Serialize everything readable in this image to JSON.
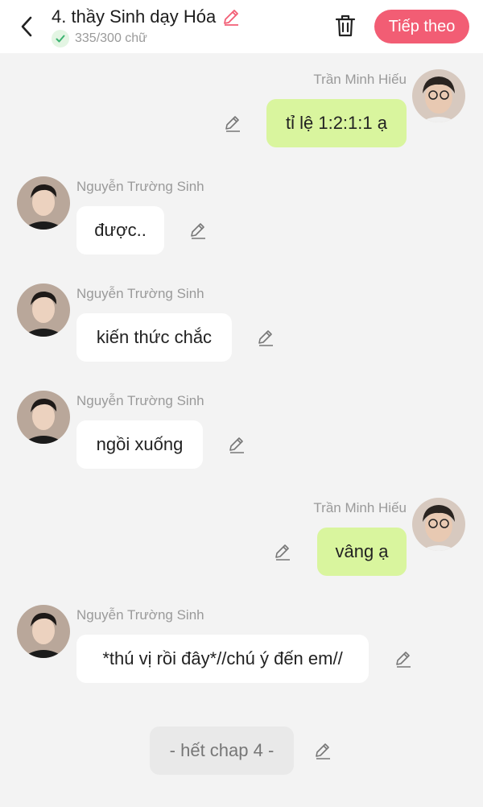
{
  "header": {
    "title": "4. thầy Sinh dạy Hóa",
    "word_count": "335/300 chữ",
    "next_label": "Tiếp theo",
    "accent_color": "#f25d74"
  },
  "messages": [
    {
      "sender": "Trần Minh Hiếu",
      "text": "tỉ lệ 1:2:1:1 ạ",
      "side": "right"
    },
    {
      "sender": "Nguyễn Trường Sinh",
      "text": "được..",
      "side": "left"
    },
    {
      "sender": "Nguyễn Trường Sinh",
      "text": "kiến thức chắc",
      "side": "left"
    },
    {
      "sender": "Nguyễn Trường Sinh",
      "text": "ngồi xuống",
      "side": "left"
    },
    {
      "sender": "Trần Minh Hiếu",
      "text": "vâng ạ",
      "side": "right"
    },
    {
      "sender": "Nguyễn Trường Sinh",
      "text": "*thú vị rồi đây*//chú ý đến em//",
      "side": "left"
    }
  ],
  "end_marker": "- hết chap 4 -",
  "icons": [
    "back-icon",
    "pencil-icon",
    "check-icon",
    "trash-icon",
    "edit-icon",
    "avatar-male"
  ]
}
